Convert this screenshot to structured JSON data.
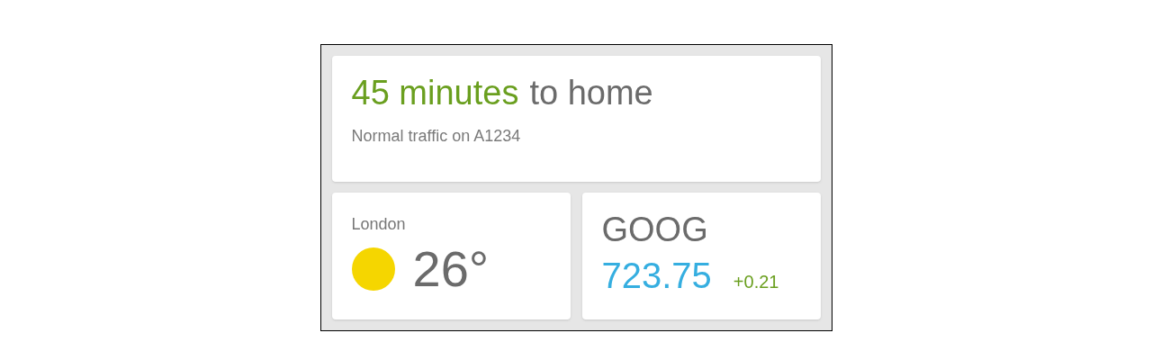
{
  "commute": {
    "duration": "45 minutes",
    "destination": "to home",
    "detail": "Normal traffic on A1234"
  },
  "weather": {
    "city": "London",
    "temperature": "26°"
  },
  "stock": {
    "symbol": "GOOG",
    "price": "723.75",
    "change": "+0.21"
  }
}
